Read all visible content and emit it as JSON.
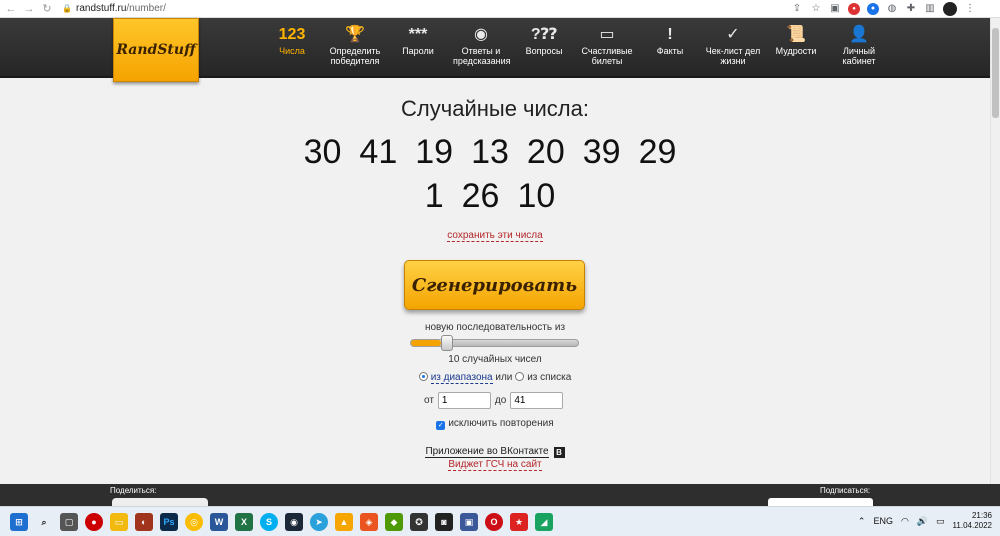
{
  "browser": {
    "url_domain": "randstuff.ru",
    "url_path": "/number/"
  },
  "site": {
    "logo_text": "RandStuff",
    "menu": [
      {
        "icon_text": "123",
        "label": "Числа",
        "icon": "numbers-icon"
      },
      {
        "icon_text": "🏆",
        "label": "Определить победителя",
        "icon": "trophy-icon"
      },
      {
        "icon_text": "***",
        "label": "Пароли",
        "icon": "password-icon"
      },
      {
        "icon_text": "◉",
        "label": "Ответы и предсказания",
        "icon": "magic-ball-icon"
      },
      {
        "icon_text": "?⁇",
        "label": "Вопросы",
        "icon": "questions-icon"
      },
      {
        "icon_text": "▭",
        "label": "Счастливые билеты",
        "icon": "ticket-icon"
      },
      {
        "icon_text": "!",
        "label": "Факты",
        "icon": "facts-icon"
      },
      {
        "icon_text": "✓",
        "label": "Чек-лист дел жизни",
        "icon": "checklist-icon"
      },
      {
        "icon_text": "📜",
        "label": "Мудрости",
        "icon": "scroll-icon"
      },
      {
        "icon_text": "👤",
        "label": "Личный кабинет",
        "icon": "user-icon"
      }
    ]
  },
  "main": {
    "title": "Случайные числа:",
    "numbers": [
      "30",
      "41",
      "19",
      "13",
      "20",
      "39",
      "29",
      "1",
      "26",
      "10"
    ],
    "save_link": "сохранить эти числа",
    "generate_button": "Сгенерировать",
    "sequence_label": "новую последовательность из",
    "slider_fraction": 0.18,
    "count_label": "10 случайных чисел",
    "range_option": "из диапазона",
    "or_text": "или",
    "list_option": "из списка",
    "from_label": "от",
    "from_value": "1",
    "to_label": "до",
    "to_value": "41",
    "exclude_repeats": "исключить повторения",
    "vk_app": "Приложение во ВКонтакте",
    "vk_badge": "B",
    "widget_link": "Виджет ГСЧ на сайт"
  },
  "footer": {
    "share_label": "Поделиться:",
    "subscribe_label": "Подписаться:"
  },
  "taskbar": {
    "lang": "ENG",
    "time": "21:36",
    "date": "11.04.2022"
  }
}
